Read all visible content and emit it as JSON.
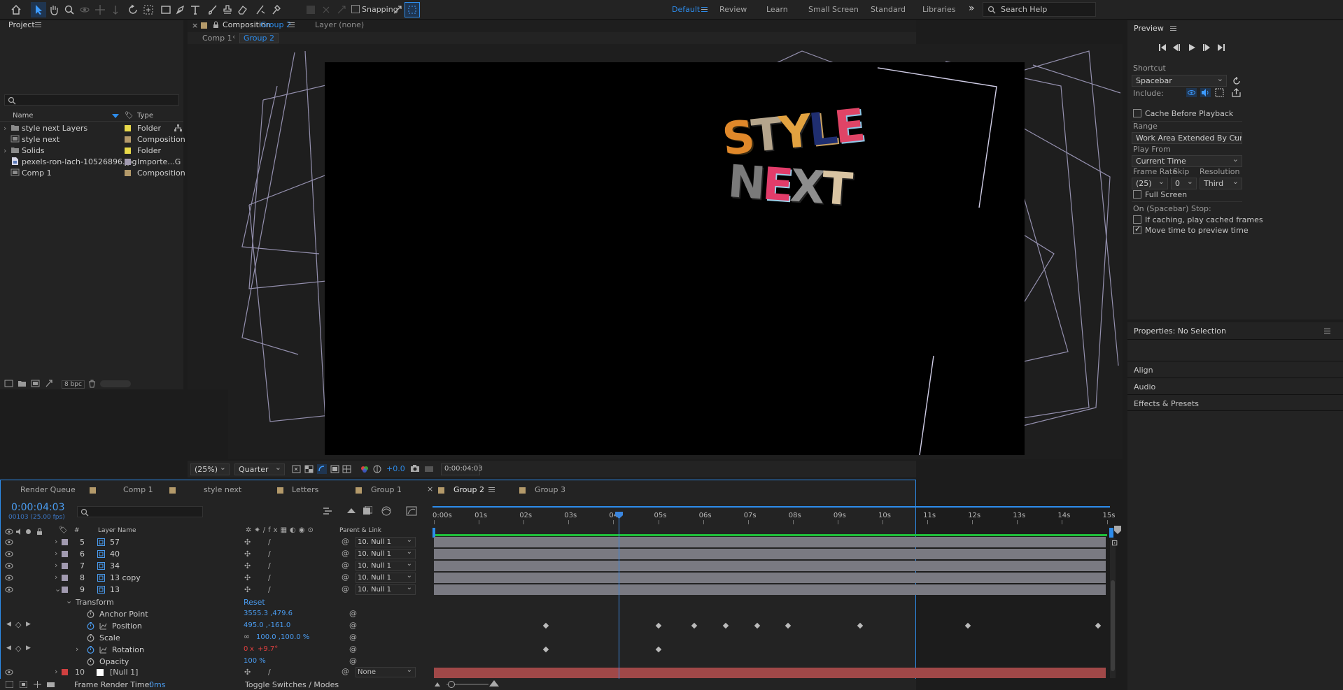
{
  "toolbar": {
    "snapping_label": "Snapping",
    "workspaces": [
      "Default",
      "Review",
      "Learn",
      "Small Screen",
      "Standard",
      "Libraries"
    ],
    "active_workspace": "Default",
    "search_placeholder": "Search Help",
    "accent": "#2d8ceb"
  },
  "project": {
    "title": "Project",
    "columns": {
      "name": "Name",
      "type": "Type"
    },
    "items": [
      {
        "name": "style next Layers",
        "type": "Folder",
        "icon": "folder-icon",
        "color": "#e8d94a",
        "expandable": true
      },
      {
        "name": "style next",
        "type": "Composition",
        "icon": "composition-icon",
        "color": "#b49a6a",
        "expandable": false
      },
      {
        "name": "Solids",
        "type": "Folder",
        "icon": "folder-icon",
        "color": "#e8d94a",
        "expandable": true
      },
      {
        "name": "pexels-ron-lach-10526896.jpg",
        "type": "Importe...G",
        "icon": "image-file-icon",
        "color": "#a19ab0",
        "expandable": false
      },
      {
        "name": "Comp 1",
        "type": "Composition",
        "icon": "composition-icon",
        "color": "#b49a6a",
        "expandable": false
      }
    ],
    "bpc": "8 bpc"
  },
  "viewer": {
    "tab_prefix": "Composition",
    "tab_name": "Group 2",
    "layer_tab": "Layer  (none)",
    "breadcrumbs": [
      "Comp 1",
      "Group 2"
    ],
    "zoom": "(25%)",
    "resolution": "Quarter",
    "exposure": "+0.0",
    "timecode": "0:00:04:03",
    "artwork_lines": [
      "STYLE",
      "NEXT"
    ]
  },
  "timeline": {
    "tabs": [
      "Render Queue",
      "Comp 1",
      "style next",
      "Letters",
      "Group 1",
      "Group 2",
      "Group 3"
    ],
    "active_tab": "Group 2",
    "timecode": "0:00:04:03",
    "frame_info": "00103 (25.00 fps)",
    "header": {
      "num": "#",
      "layer_name": "Layer Name",
      "parent": "Parent & Link"
    },
    "ruler": [
      "0:00s",
      "01s",
      "02s",
      "03s",
      "04s",
      "05s",
      "06s",
      "07s",
      "08s",
      "09s",
      "10s",
      "11s",
      "12s",
      "13s",
      "14s",
      "15s"
    ],
    "playhead_seconds": 4.12,
    "layers": [
      {
        "num": "5",
        "name": "57",
        "parent": "10. Null 1"
      },
      {
        "num": "6",
        "name": "40",
        "parent": "10. Null 1"
      },
      {
        "num": "7",
        "name": "34",
        "parent": "10. Null 1"
      },
      {
        "num": "8",
        "name": "13 copy",
        "parent": "10. Null 1"
      },
      {
        "num": "9",
        "name": "13",
        "parent": "10. Null 1"
      }
    ],
    "transform": {
      "label": "Transform",
      "reset": "Reset",
      "props": [
        {
          "name": "Anchor Point",
          "value": "3555.3 ,479.6"
        },
        {
          "name": "Position",
          "value": "495.0 ,-161.0"
        },
        {
          "name": "Scale",
          "value": "100.0 ,100.0 %"
        },
        {
          "name": "Rotation",
          "value_prefix": "0",
          "value_x": "x",
          "value": "+9.7°"
        },
        {
          "name": "Opacity",
          "value": "100 %"
        }
      ]
    },
    "null_layer": {
      "num": "10",
      "name": "[Null 1]",
      "parent": "None"
    },
    "position_keyframes_seconds": [
      2.5,
      5.0,
      5.8,
      6.5,
      7.2,
      7.9,
      9.5,
      11.9,
      14.8
    ],
    "rotation_keyframes_seconds": [
      2.5,
      5.0
    ],
    "frame_render_label": "Frame Render Time:",
    "frame_render_value": "0ms",
    "toggle_label": "Toggle Switches / Modes"
  },
  "preview": {
    "title": "Preview",
    "shortcut_label": "Shortcut",
    "shortcut": "Spacebar",
    "include_label": "Include:",
    "cache_before_playback": "Cache Before Playback",
    "range_label": "Range",
    "range": "Work Area Extended By Current...",
    "play_from_label": "Play From",
    "play_from": "Current Time",
    "frame_rate_label": "Frame Rate",
    "frame_rate": "(25)",
    "skip_label": "Skip",
    "skip": "0",
    "resolution_label": "Resolution",
    "resolution": "Third",
    "full_screen": "Full Screen",
    "on_stop_label": "On (Spacebar) Stop:",
    "if_caching": "If caching, play cached frames",
    "move_time": "Move time to preview time"
  },
  "properties": {
    "title": "Properties: No Selection",
    "sections": [
      "Align",
      "Audio",
      "Effects & Presets"
    ]
  }
}
